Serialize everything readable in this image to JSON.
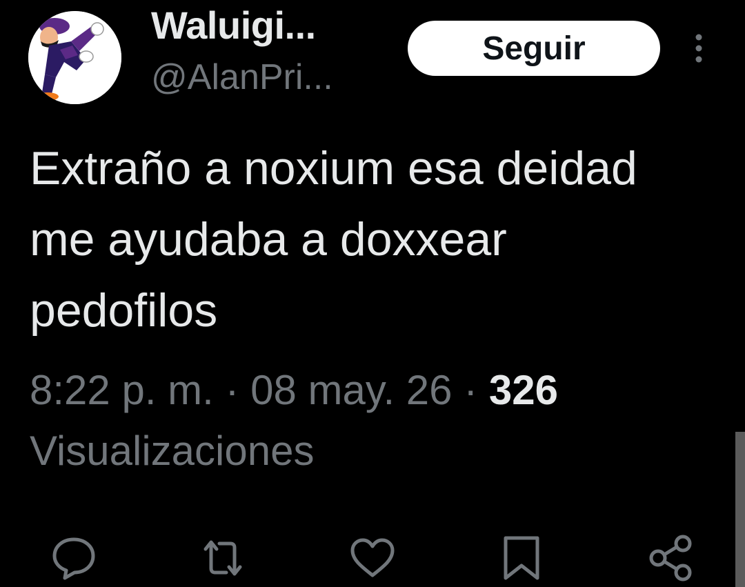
{
  "author": {
    "display_name": "Waluigi...",
    "handle": "@AlanPri...",
    "avatar_icon": "waluigi-avatar"
  },
  "follow_button": {
    "label": "Seguir"
  },
  "more_button": {
    "icon": "more-vertical-icon"
  },
  "tweet": {
    "text": "Extraño a noxium esa deidad me ayudaba a doxxear pedofilos",
    "time": "8:22 p. m.",
    "separator": "·",
    "date": "08 may. 26",
    "views_count": "326",
    "views_label": "Visualizaciones"
  },
  "actions": [
    {
      "icon": "reply-icon"
    },
    {
      "icon": "retweet-icon"
    },
    {
      "icon": "like-icon"
    },
    {
      "icon": "bookmark-icon"
    },
    {
      "icon": "share-icon"
    }
  ],
  "colors": {
    "background": "#000000",
    "primary_text": "#e7e9ea",
    "secondary_text": "#71767b",
    "follow_button_bg": "#ffffff",
    "follow_button_text": "#0f1419",
    "avatar_purple": "#5b2a86"
  }
}
